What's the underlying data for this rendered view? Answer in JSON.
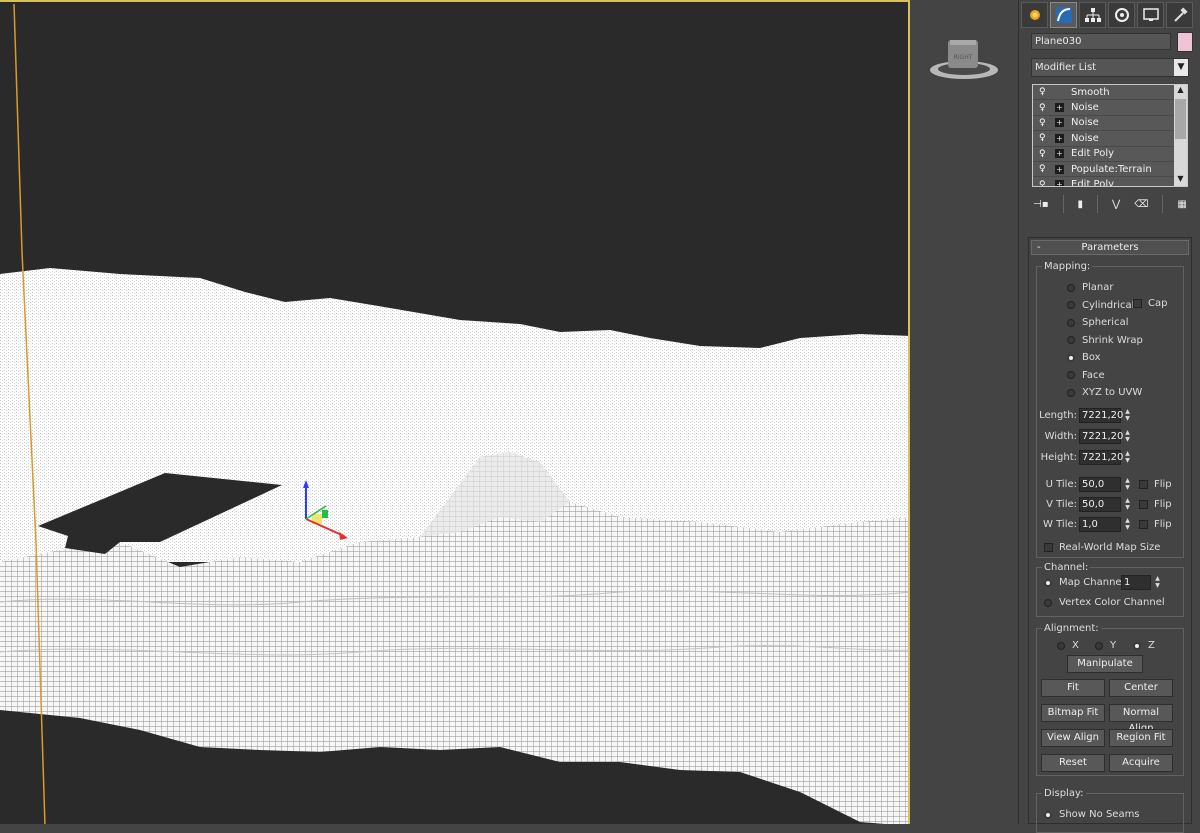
{
  "toolbar": {
    "tabs": [
      {
        "name": "create-tab",
        "icon": "sun-icon",
        "active": false
      },
      {
        "name": "modify-tab",
        "icon": "modify-curve-icon",
        "active": true
      },
      {
        "name": "hierarchy-tab",
        "icon": "hierarchy-icon",
        "active": false
      },
      {
        "name": "motion-tab",
        "icon": "motion-circle-icon",
        "active": false
      },
      {
        "name": "display-tab",
        "icon": "monitor-icon",
        "active": false
      },
      {
        "name": "utilities-tab",
        "icon": "hammer-icon",
        "active": false
      }
    ]
  },
  "object": {
    "name": "Plane030",
    "color": "#f0c4d8"
  },
  "modifier_list": {
    "label": "Modifier List"
  },
  "stack": {
    "items": [
      {
        "label": "Smooth",
        "expandable": false
      },
      {
        "label": "Noise",
        "expandable": true
      },
      {
        "label": "Noise",
        "expandable": true
      },
      {
        "label": "Noise",
        "expandable": true
      },
      {
        "label": "Edit Poly",
        "expandable": true
      },
      {
        "label": "Populate:Terrain",
        "expandable": true
      },
      {
        "label": "Edit Poly",
        "expandable": true
      }
    ]
  },
  "viewcube": {
    "label": "RIGHT"
  },
  "gizmo": {
    "z_label": "Z"
  },
  "params": {
    "title": "Parameters",
    "collapse": "-",
    "mapping": {
      "title": "Mapping:",
      "options": [
        "Planar",
        "Cylindrical",
        "Spherical",
        "Shrink Wrap",
        "Box",
        "Face",
        "XYZ to UVW"
      ],
      "selected": "Box",
      "cap_label": "Cap"
    },
    "length": {
      "label": "Length:",
      "value": "7221,20"
    },
    "width": {
      "label": "Width:",
      "value": "7221,20"
    },
    "height": {
      "label": "Height:",
      "value": "7221,20"
    },
    "utile": {
      "label": "U Tile:",
      "value": "50,0"
    },
    "vtile": {
      "label": "V Tile:",
      "value": "50,0"
    },
    "wtile": {
      "label": "W Tile:",
      "value": "1,0"
    },
    "flip_label": "Flip",
    "realworld_label": "Real-World Map Size",
    "channel": {
      "title": "Channel:",
      "map_channel_label": "Map Channel:",
      "map_channel_value": "1",
      "vertex_label": "Vertex Color Channel"
    },
    "alignment": {
      "title": "Alignment:",
      "x": "X",
      "y": "Y",
      "z": "Z",
      "selected": "Z",
      "buttons": {
        "manipulate": "Manipulate",
        "fit": "Fit",
        "center": "Center",
        "bitmap_fit": "Bitmap Fit",
        "normal_align": "Normal Align",
        "view_align": "View Align",
        "region_fit": "Region Fit",
        "reset": "Reset",
        "acquire": "Acquire"
      }
    },
    "display": {
      "title": "Display:",
      "show_no_seams": "Show No Seams"
    }
  }
}
